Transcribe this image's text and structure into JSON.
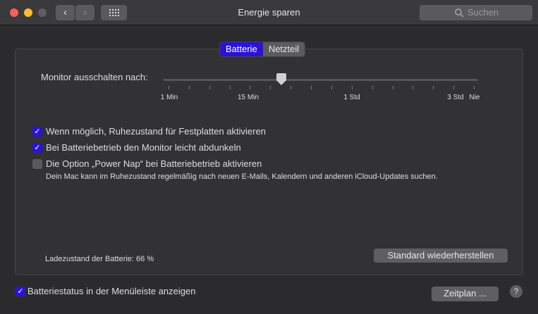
{
  "window": {
    "title": "Energie sparen",
    "search_placeholder": "Suchen"
  },
  "tabs": [
    {
      "label": "Batterie",
      "active": true
    },
    {
      "label": "Netzteil",
      "active": false
    }
  ],
  "slider": {
    "label": "Monitor ausschalten nach:",
    "value_fraction": 0.376,
    "tick_labels": [
      "1 Min",
      "15 Min",
      "1 Std",
      "3 Std",
      "Nie"
    ]
  },
  "options": [
    {
      "label": "Wenn möglich, Ruhezustand für Festplatten aktivieren",
      "checked": true
    },
    {
      "label": "Bei Batteriebetrieb den Monitor leicht abdunkeln",
      "checked": true
    },
    {
      "label": "Die Option „Power Nap“ bei Batteriebetrieb aktivieren",
      "checked": false
    }
  ],
  "power_nap_description": "Dein Mac kann im Ruhezustand regelmäßig nach neuen E-Mails, Kalendern und anderen iCloud-Updates suchen.",
  "battery_level": "Ladezustand der Batterie: 66 %",
  "restore_button": "Standard wiederherstellen",
  "menubar_option": {
    "label": "Batteriestatus in der Menüleiste anzeigen",
    "checked": true
  },
  "schedule_button": "Zeitplan ...",
  "help_button": "?",
  "colors": {
    "accent": "#2a12d8"
  }
}
